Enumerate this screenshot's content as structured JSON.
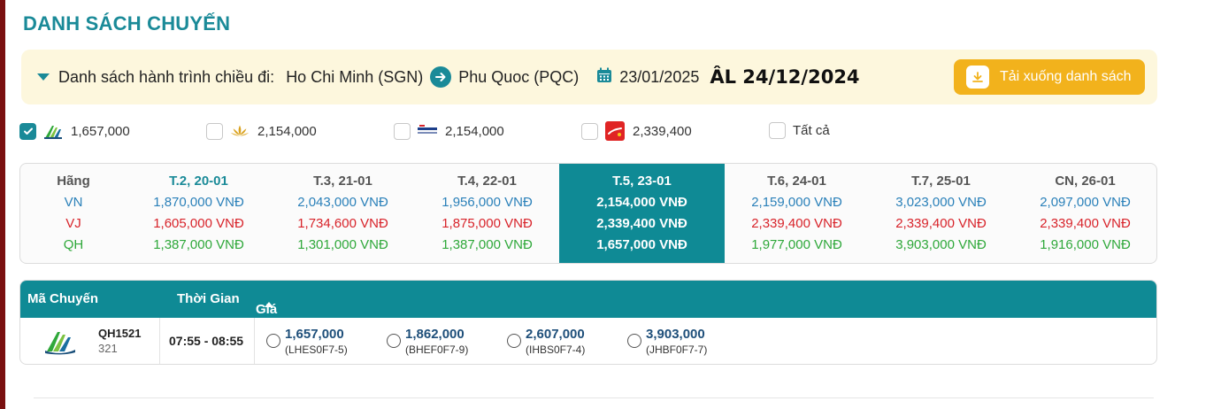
{
  "title": "DANH SÁCH CHUYẾN",
  "banner": {
    "label": "Danh sách hành trình chiều đi:",
    "origin": "Ho Chi Minh (SGN)",
    "destination": "Phu Quoc (PQC)",
    "date": "23/01/2025",
    "lunar_date": "ÂL 24/12/2024",
    "download_label": "Tải xuống danh sách"
  },
  "filters": [
    {
      "airline": "Bamboo Airways",
      "price": "1,657,000",
      "checked": true
    },
    {
      "airline": "Vietnam Airlines",
      "price": "2,154,000",
      "checked": false
    },
    {
      "airline": "Pacific Airlines",
      "price": "2,154,000",
      "checked": false
    },
    {
      "airline": "Vietjet Air",
      "price": "2,339,400",
      "checked": false
    },
    {
      "label": "Tất cả",
      "checked": false
    }
  ],
  "price_grid": {
    "row_header": "Hãng",
    "airline_codes": [
      "VN",
      "VJ",
      "QH"
    ],
    "days": [
      {
        "label": "T.2, 20-01",
        "vn": "1,870,000 VNĐ",
        "vj": "1,605,000 VNĐ",
        "qh": "1,387,000 VNĐ"
      },
      {
        "label": "T.3, 21-01",
        "vn": "2,043,000 VNĐ",
        "vj": "1,734,600 VNĐ",
        "qh": "1,301,000 VNĐ"
      },
      {
        "label": "T.4, 22-01",
        "vn": "1,956,000 VNĐ",
        "vj": "1,875,000 VNĐ",
        "qh": "1,387,000 VNĐ"
      },
      {
        "label": "T.5, 23-01",
        "vn": "2,154,000 VNĐ",
        "vj": "2,339,400 VNĐ",
        "qh": "1,657,000 VNĐ",
        "active": true
      },
      {
        "label": "T.6, 24-01",
        "vn": "2,159,000 VNĐ",
        "vj": "2,339,400 VNĐ",
        "qh": "1,977,000 VNĐ"
      },
      {
        "label": "T.7, 25-01",
        "vn": "3,023,000 VNĐ",
        "vj": "2,339,400 VNĐ",
        "qh": "3,903,000 VNĐ"
      },
      {
        "label": "CN, 26-01",
        "vn": "2,097,000 VNĐ",
        "vj": "2,339,400 VNĐ",
        "qh": "1,916,000 VNĐ"
      }
    ]
  },
  "flight_table": {
    "headers": {
      "code": "Mã Chuyến",
      "time": "Thời Gian",
      "price": "Giá Vé"
    },
    "rows": [
      {
        "flight_code": "QH1521",
        "aircraft": "321",
        "time": "07:55 - 08:55",
        "fares": [
          {
            "price": "1,657,000",
            "code": "(LHES0F7-5)"
          },
          {
            "price": "1,862,000",
            "code": "(BHEF0F7-9)"
          },
          {
            "price": "2,607,000",
            "code": "(IHBS0F7-4)"
          },
          {
            "price": "3,903,000",
            "code": "(JHBF0F7-7)"
          }
        ]
      }
    ]
  },
  "colors": {
    "teal": "#0f8a95",
    "gold": "#f2b21c",
    "vn_blue": "#2a80b9",
    "vj_red": "#d8232a",
    "qh_green": "#2fa83a"
  }
}
